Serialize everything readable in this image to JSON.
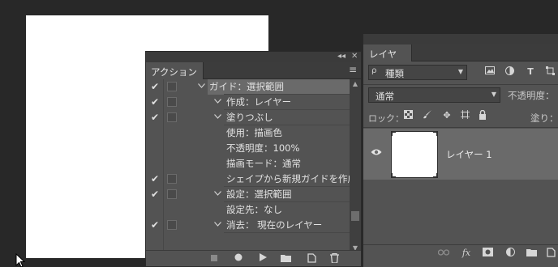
{
  "actions_panel": {
    "tab": "アクション",
    "collapse_glyph": "◂◂",
    "close_glyph": "✕",
    "menu_glyph": "≡",
    "rows": [
      {
        "checked": true,
        "indent": 0,
        "twirl": "v",
        "label": "ガイド：選択範囲",
        "selected": true
      },
      {
        "checked": true,
        "indent": 1,
        "twirl": "v",
        "label": "作成：レイヤー"
      },
      {
        "checked": true,
        "indent": 1,
        "twirl": "v",
        "label": "塗りつぶし"
      },
      {
        "checked": false,
        "indent": 2,
        "twirl": "",
        "label": "使用：描画色",
        "plain": true
      },
      {
        "checked": false,
        "indent": 2,
        "twirl": "",
        "label": "不透明度：100%",
        "plain": true
      },
      {
        "checked": false,
        "indent": 2,
        "twirl": "",
        "label": "描画モード：通常",
        "plain": true
      },
      {
        "checked": true,
        "indent": 1,
        "twirl": "",
        "label": "シェイプから新規ガイドを作成"
      },
      {
        "checked": true,
        "indent": 1,
        "twirl": "v",
        "label": "設定：選択範囲"
      },
      {
        "checked": false,
        "indent": 2,
        "twirl": "",
        "label": "設定先：なし",
        "plain": true
      },
      {
        "checked": true,
        "indent": 1,
        "twirl": "v",
        "label": "消去： 現在のレイヤー"
      }
    ],
    "bottom_icons": [
      "stop-icon",
      "record-icon",
      "play-icon",
      "folder-icon",
      "new-action-icon",
      "trash-icon"
    ]
  },
  "layers_panel": {
    "tab": "レイヤー",
    "filter_value": "種類",
    "filter_glyph": "ρ",
    "blend_mode": "通常",
    "opacity_label": "不透明度：",
    "lock_label": "ロック：",
    "fill_label": "塗り：",
    "layer_name": "レイヤー 1",
    "footer_icons": [
      "link-icon",
      "fx-icon",
      "mask-icon",
      "adjustment-icon",
      "group-folder-icon",
      "new-layer-icon"
    ]
  }
}
